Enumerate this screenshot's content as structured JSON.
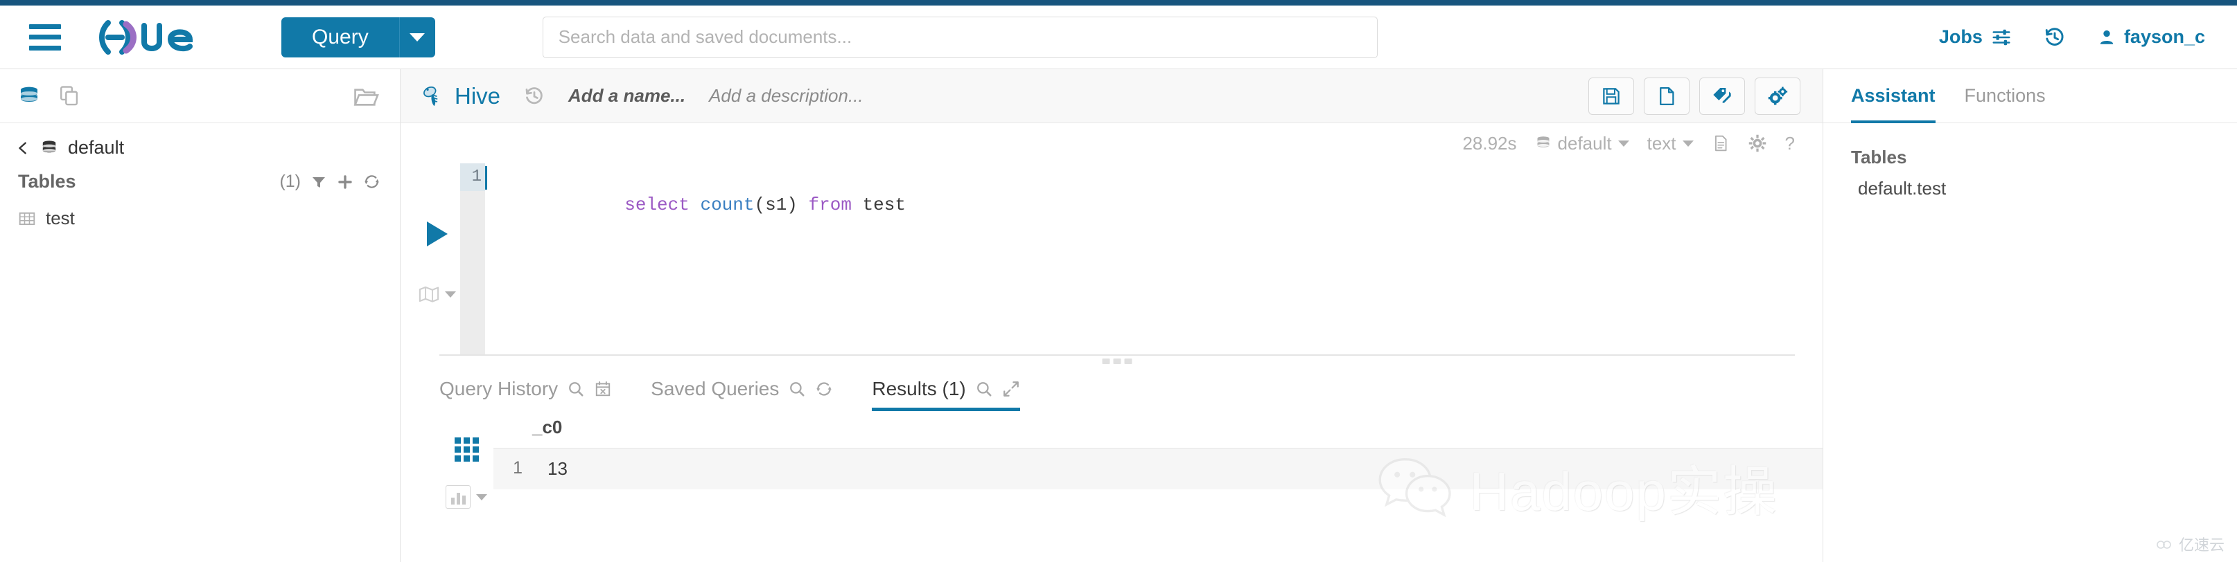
{
  "colors": {
    "brand_blue": "#1179a8",
    "dark_strip": "#17557e",
    "text_dark": "#3b3b3b",
    "muted": "#9b9b9b"
  },
  "header": {
    "menu_icon": "hamburger-icon",
    "logo_text": "hue",
    "query_button": "Query",
    "query_caret_icon": "chevron-down-icon",
    "search": {
      "placeholder": "Search data and saved documents...",
      "value": ""
    },
    "jobs_label": "Jobs",
    "jobs_icon": "sliders-icon",
    "history_icon": "history-icon",
    "user_icon": "user-icon",
    "username": "fayson_c"
  },
  "left_panel": {
    "tab_icons": [
      "database-icon",
      "documents-icon"
    ],
    "folder_icon": "folder-open-icon",
    "back_icon": "chevron-left-icon",
    "database_icon": "database-icon",
    "database_name": "default",
    "tables_label": "Tables",
    "tables_count": "(1)",
    "filter_icon": "filter-icon",
    "add_icon": "plus-icon",
    "refresh_icon": "refresh-icon",
    "tables": [
      {
        "icon": "table-icon",
        "name": "test"
      }
    ]
  },
  "editor": {
    "engine_icon": "hive-bee-icon",
    "engine_name": "Hive",
    "history_icon": "history-icon",
    "name_placeholder": "Add a name...",
    "description_placeholder": "Add a description...",
    "toolbar": [
      {
        "icon": "save-icon",
        "name": "save-button"
      },
      {
        "icon": "new-document-icon",
        "name": "new-document-button"
      },
      {
        "icon": "tags-icon",
        "name": "tags-button"
      },
      {
        "icon": "settings-gears-icon",
        "name": "settings-button"
      }
    ],
    "meta": {
      "elapsed": "28.92s",
      "database_icon": "database-icon",
      "database": "default",
      "format": "text",
      "document_icon": "document-icon",
      "gear_icon": "gear-icon",
      "help_icon": "question-mark-icon"
    },
    "run_icon": "play-icon",
    "map_icon": "map-icon",
    "map_caret_icon": "chevron-down-icon",
    "line_number": "1",
    "sql_tokens": [
      {
        "text": "select",
        "type": "keyword"
      },
      {
        "text": " ",
        "type": "plain"
      },
      {
        "text": "count",
        "type": "function"
      },
      {
        "text": "(s1)",
        "type": "punct"
      },
      {
        "text": " ",
        "type": "plain"
      },
      {
        "text": "from",
        "type": "keyword"
      },
      {
        "text": " ",
        "type": "plain"
      },
      {
        "text": "test",
        "type": "identifier"
      }
    ],
    "sql_text": "select count(s1) from test"
  },
  "result_tabs": [
    {
      "label": "Query History",
      "icons": [
        "search-icon",
        "calendar-x-icon"
      ],
      "active": false
    },
    {
      "label": "Saved Queries",
      "icons": [
        "search-icon",
        "refresh-icon"
      ],
      "active": false
    },
    {
      "label": "Results (1)",
      "icons": [
        "search-icon",
        "expand-icon"
      ],
      "active": true
    }
  ],
  "results": {
    "grid_icon": "grid-view-icon",
    "chart_icon": "bar-chart-icon",
    "chart_caret_icon": "chevron-down-icon",
    "columns": [
      "_c0"
    ],
    "rows": [
      {
        "index": "1",
        "values": [
          "13"
        ]
      }
    ]
  },
  "right_panel": {
    "tabs": [
      {
        "label": "Assistant",
        "active": true
      },
      {
        "label": "Functions",
        "active": false
      }
    ],
    "section_title": "Tables",
    "items": [
      "default.test"
    ]
  },
  "watermarks": {
    "wechat_icon": "wechat-icon",
    "wechat_text": "Hadoop实操",
    "corner_icon": "cloud-icon",
    "corner_text": "亿速云"
  }
}
